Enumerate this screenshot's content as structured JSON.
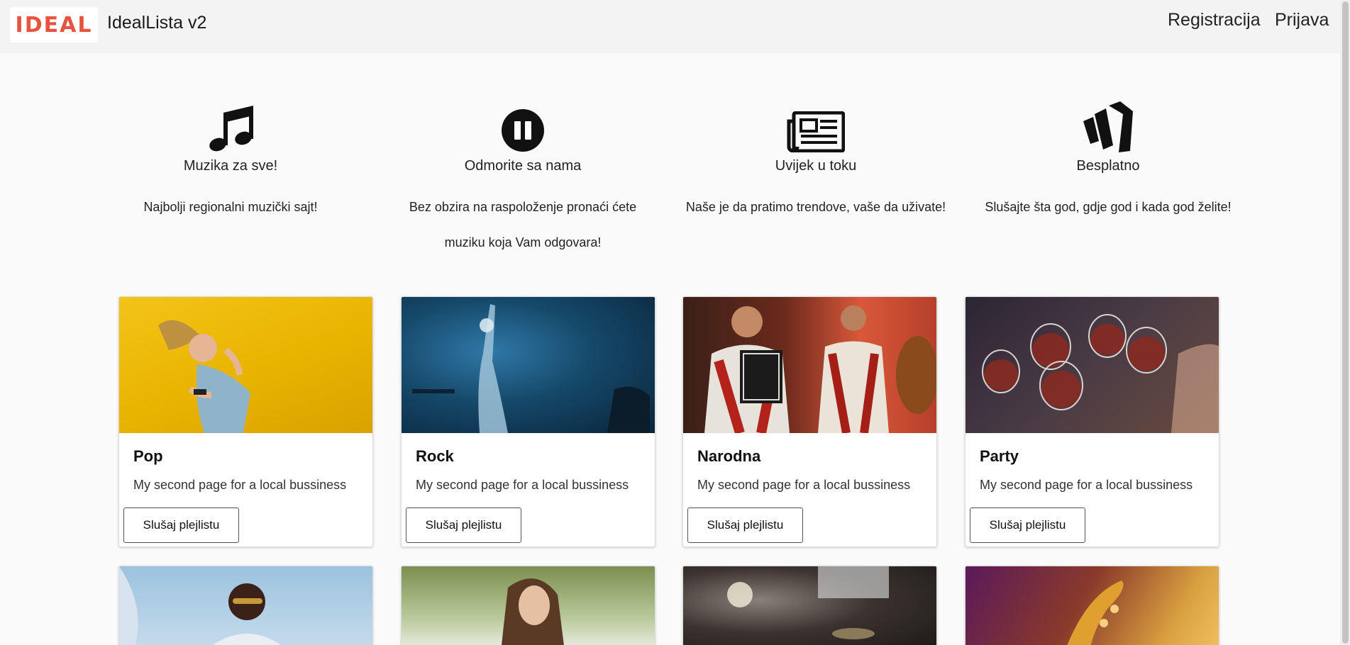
{
  "navbar": {
    "logo_text": "IDEAL",
    "brand_name": "IdealLista v2",
    "links": {
      "register": "Registracija",
      "login": "Prijava"
    }
  },
  "features": [
    {
      "icon": "music-note-icon",
      "title": "Muzika za sve!",
      "description": "Najbolji regionalni muzički sajt!"
    },
    {
      "icon": "pause-circle-icon",
      "title": "Odmorite sa nama",
      "description": "Bez obzira na raspoloženje pronaći ćete muziku koja Vam odgovara!"
    },
    {
      "icon": "newspaper-icon",
      "title": "Uvijek u toku",
      "description": "Naše je da pratimo trendove, vaše da uživate!"
    },
    {
      "icon": "wave-logo-icon",
      "title": "Besplatno",
      "description": "Slušajte šta god, gdje god i kada god želite!"
    }
  ],
  "cards": [
    {
      "title": "Pop",
      "text": "My second page for a local bussiness",
      "button": "Slušaj plejlistu",
      "image": "woman-headphones-yellow-photo"
    },
    {
      "title": "Rock",
      "text": "My second page for a local bussiness",
      "button": "Slušaj plejlistu",
      "image": "rock-guitarist-stage-photo"
    },
    {
      "title": "Narodna",
      "text": "My second page for a local bussiness",
      "button": "Slušaj plejlistu",
      "image": "accordion-players-photo"
    },
    {
      "title": "Party",
      "text": "My second page for a local bussiness",
      "button": "Slušaj plejlistu",
      "image": "wine-glasses-toast-photo"
    }
  ],
  "cards_row2": [
    {
      "image": "man-sunglasses-photo"
    },
    {
      "image": "girl-outdoors-photo"
    },
    {
      "image": "stage-drums-photo"
    },
    {
      "image": "saxophone-photo"
    }
  ]
}
